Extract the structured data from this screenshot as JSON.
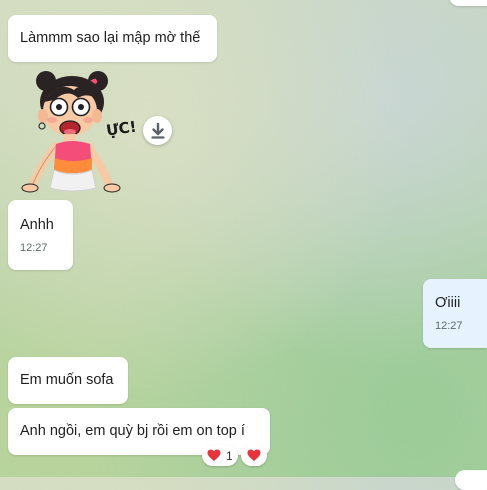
{
  "messages": [
    {
      "text": "Làmmm sao lại mập mờ thế"
    },
    {
      "sticker": "surprised-girl-sticker",
      "sticker_text": "ỰC!"
    },
    {
      "text": "Anhh",
      "time": "12:27"
    },
    {
      "text": "Ơiiii",
      "time": "12:27"
    },
    {
      "text": "Em muốn sofa"
    },
    {
      "text": "Anh ngồi, em quỳ bj rồi em on top í"
    }
  ],
  "reactions": {
    "heart_count": "1"
  },
  "icons": {
    "download": "download-icon",
    "reaction": "heart-icon"
  },
  "colors": {
    "incoming_bubble": "#ffffff",
    "outgoing_bubble": "#e6f3ff",
    "heart": "#e8323c"
  }
}
